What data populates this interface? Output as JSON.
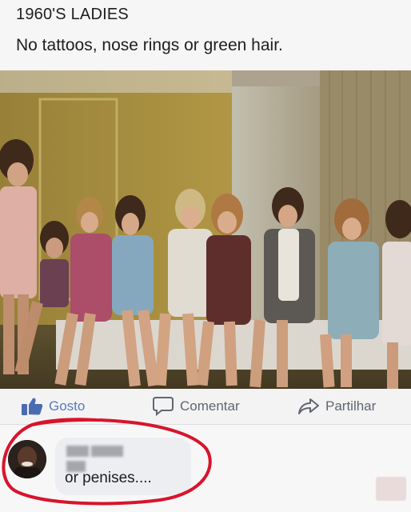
{
  "post": {
    "title": "1960'S LADIES",
    "caption": "No tattoos, nose rings or green hair."
  },
  "actions": {
    "like_label": "Gosto",
    "comment_label": "Comentar",
    "share_label": "Partilhar"
  },
  "comment": {
    "text": "or penises....",
    "author_obscured": true
  },
  "icons": {
    "like": "thumbs-up-icon",
    "comment": "speech-bubble-icon",
    "share": "share-arrow-icon"
  },
  "colors": {
    "like_accent": "#5b79b8",
    "action_text": "#606770",
    "highlight": "#d8142b"
  }
}
